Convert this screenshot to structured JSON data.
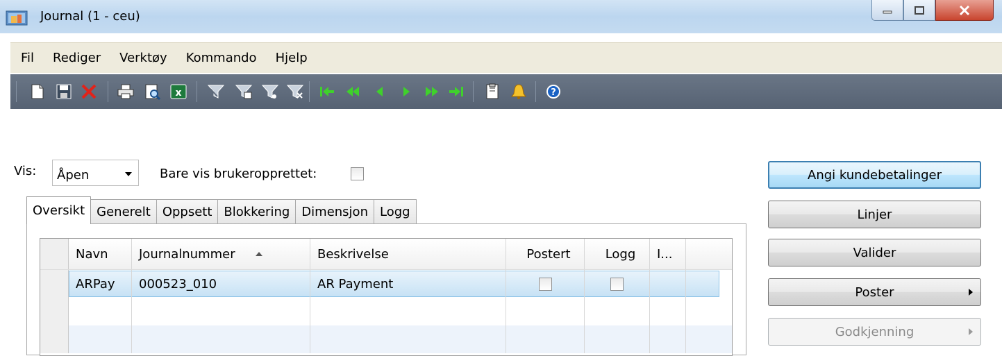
{
  "window": {
    "title": "Journal (1 - ceu)"
  },
  "menu": {
    "items": [
      "Fil",
      "Rediger",
      "Verktøy",
      "Kommando",
      "Hjelp"
    ]
  },
  "toolbar": {
    "icons": [
      "new-icon",
      "save-icon",
      "delete-icon",
      "print-icon",
      "print-preview-icon",
      "excel-icon",
      "filter-by-selection-icon",
      "filter-by-grid-icon",
      "advanced-filter-icon",
      "remove-filter-icon",
      "first-record-icon",
      "previous-page-icon",
      "previous-record-icon",
      "next-record-icon",
      "next-page-icon",
      "last-record-icon",
      "document-handling-icon",
      "alert-icon",
      "help-icon"
    ]
  },
  "filter": {
    "vis_label": "Vis:",
    "vis_value": "Åpen",
    "bare_label": "Bare vis brukeropprettet:",
    "bare_checked": false
  },
  "tabs": [
    "Oversikt",
    "Generelt",
    "Oppsett",
    "Blokkering",
    "Dimensjon",
    "Logg"
  ],
  "active_tab": "Oversikt",
  "grid": {
    "columns": [
      "Navn",
      "Journalnummer",
      "Beskrivelse",
      "Postert",
      "Logg",
      "I..."
    ],
    "sorted_column": "Journalnummer",
    "rows": [
      {
        "navn": "ARPay",
        "journalnummer": "000523_010",
        "beskrivelse": "AR Payment",
        "postert": false,
        "logg": false
      }
    ]
  },
  "buttons": {
    "angi": "Angi kundebetalinger",
    "linjer": "Linjer",
    "valider": "Valider",
    "poster": "Poster",
    "godkjenning": "Godkjenning"
  },
  "colors": {
    "titlebar": "#c4dbf1",
    "menubar": "#eeebdd",
    "toolbar": "#5e6a7b",
    "selected_row": "#c7e2f5",
    "primary_button_border": "#3c7fb1"
  }
}
